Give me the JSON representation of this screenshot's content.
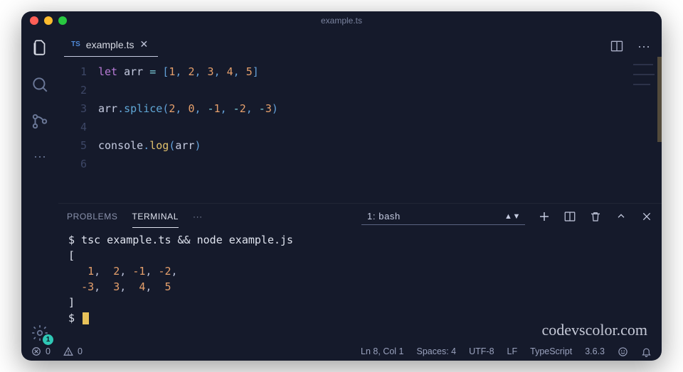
{
  "window": {
    "title": "example.ts"
  },
  "tab": {
    "language_badge": "TS",
    "filename": "example.ts"
  },
  "code": {
    "lines": [
      {
        "n": 1,
        "html": "<span class='tk-kw'>let</span> <span class='tk-id'>arr</span> <span class='tk-op'>=</span> <span class='tk-pun'>[</span><span class='tk-num'>1</span><span class='tk-pun'>,</span> <span class='tk-num'>2</span><span class='tk-pun'>,</span> <span class='tk-num'>3</span><span class='tk-pun'>,</span> <span class='tk-num'>4</span><span class='tk-pun'>,</span> <span class='tk-num'>5</span><span class='tk-pun'>]</span>"
      },
      {
        "n": 2,
        "html": ""
      },
      {
        "n": 3,
        "html": "<span class='tk-id'>arr</span><span class='tk-pun'>.</span><span class='tk-fn'>splice</span><span class='tk-pun'>(</span><span class='tk-num'>2</span><span class='tk-pun'>,</span> <span class='tk-num'>0</span><span class='tk-pun'>,</span> <span class='tk-op'>-</span><span class='tk-num'>1</span><span class='tk-pun'>,</span> <span class='tk-op'>-</span><span class='tk-num'>2</span><span class='tk-pun'>,</span> <span class='tk-op'>-</span><span class='tk-num'>3</span><span class='tk-pun'>)</span>"
      },
      {
        "n": 4,
        "html": ""
      },
      {
        "n": 5,
        "html": "<span class='tk-obj'>console</span><span class='tk-pun'>.</span><span class='tk-fn2'>log</span><span class='tk-pun'>(</span><span class='tk-id'>arr</span><span class='tk-pun'>)</span>"
      },
      {
        "n": 6,
        "html": ""
      }
    ],
    "plain": [
      "let arr = [1, 2, 3, 4, 5]",
      "",
      "arr.splice(2, 0, -1, -2, -3)",
      "",
      "console.log(arr)",
      ""
    ]
  },
  "panel": {
    "tabs": {
      "problems": "PROBLEMS",
      "terminal": "TERMINAL"
    },
    "shell_selector": "1: bash"
  },
  "terminal": {
    "command": "$ tsc example.ts && node example.js",
    "output_lines": [
      "[",
      "   1,  2, -1, -2,",
      "  -3,  3,  4,  5",
      "]"
    ],
    "prompt": "$ "
  },
  "status": {
    "errors": "0",
    "warnings": "0",
    "line_col": "Ln 8, Col 1",
    "spaces": "Spaces: 4",
    "encoding": "UTF-8",
    "eol": "LF",
    "language": "TypeScript",
    "version": "3.6.3"
  },
  "settings_badge": "1",
  "watermark": "codevscolor.com"
}
